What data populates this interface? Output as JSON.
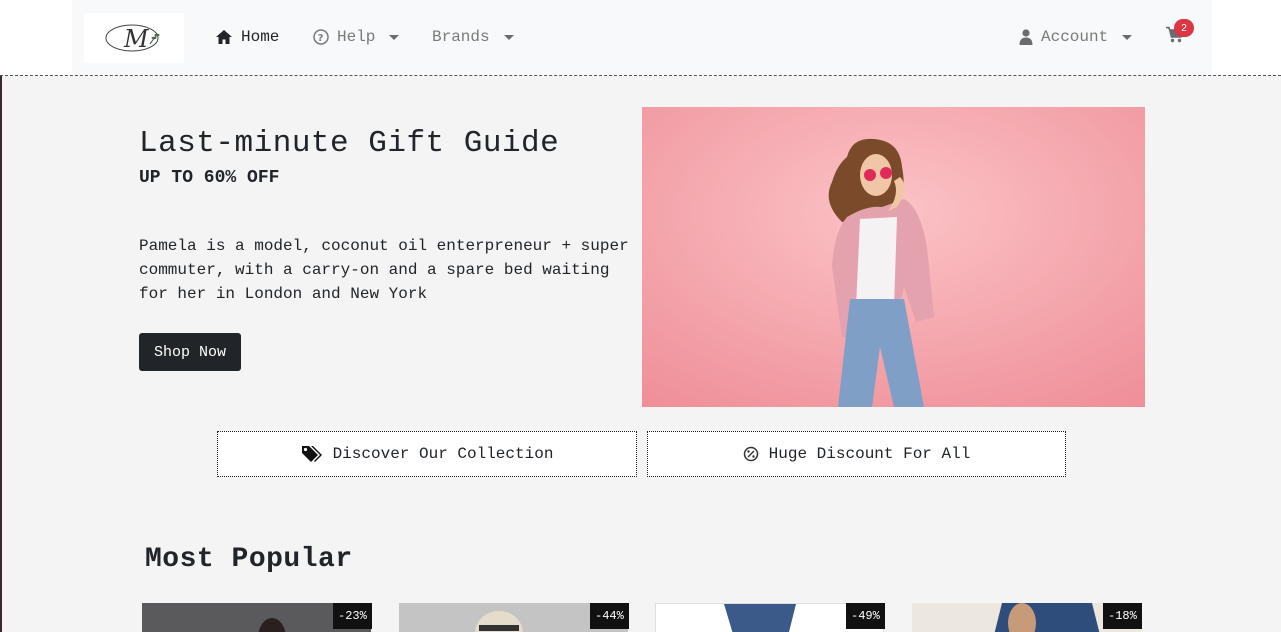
{
  "nav": {
    "logo_letter": "M",
    "home": "Home",
    "help": "Help",
    "brands": "Brands",
    "account": "Account",
    "cart_count": "2"
  },
  "hero": {
    "title": "Last-minute Gift Guide",
    "subtitle": "UP TO 60% OFF",
    "text": "Pamela is a model, coconut oil enterpreneur + super commuter, with a carry-on and a spare bed waiting for her in London and New York",
    "button": "Shop Now"
  },
  "features": {
    "collection": "Discover Our Collection",
    "discount": "Huge Discount For All"
  },
  "popular": {
    "title": "Most Popular",
    "items": [
      {
        "discount": "-23%"
      },
      {
        "discount": "-44%"
      },
      {
        "discount": "-49%"
      },
      {
        "discount": "-18%"
      }
    ]
  },
  "colors": {
    "badge": "#dc3545",
    "button": "#212529",
    "hero_bg": "#f4a3aa"
  }
}
